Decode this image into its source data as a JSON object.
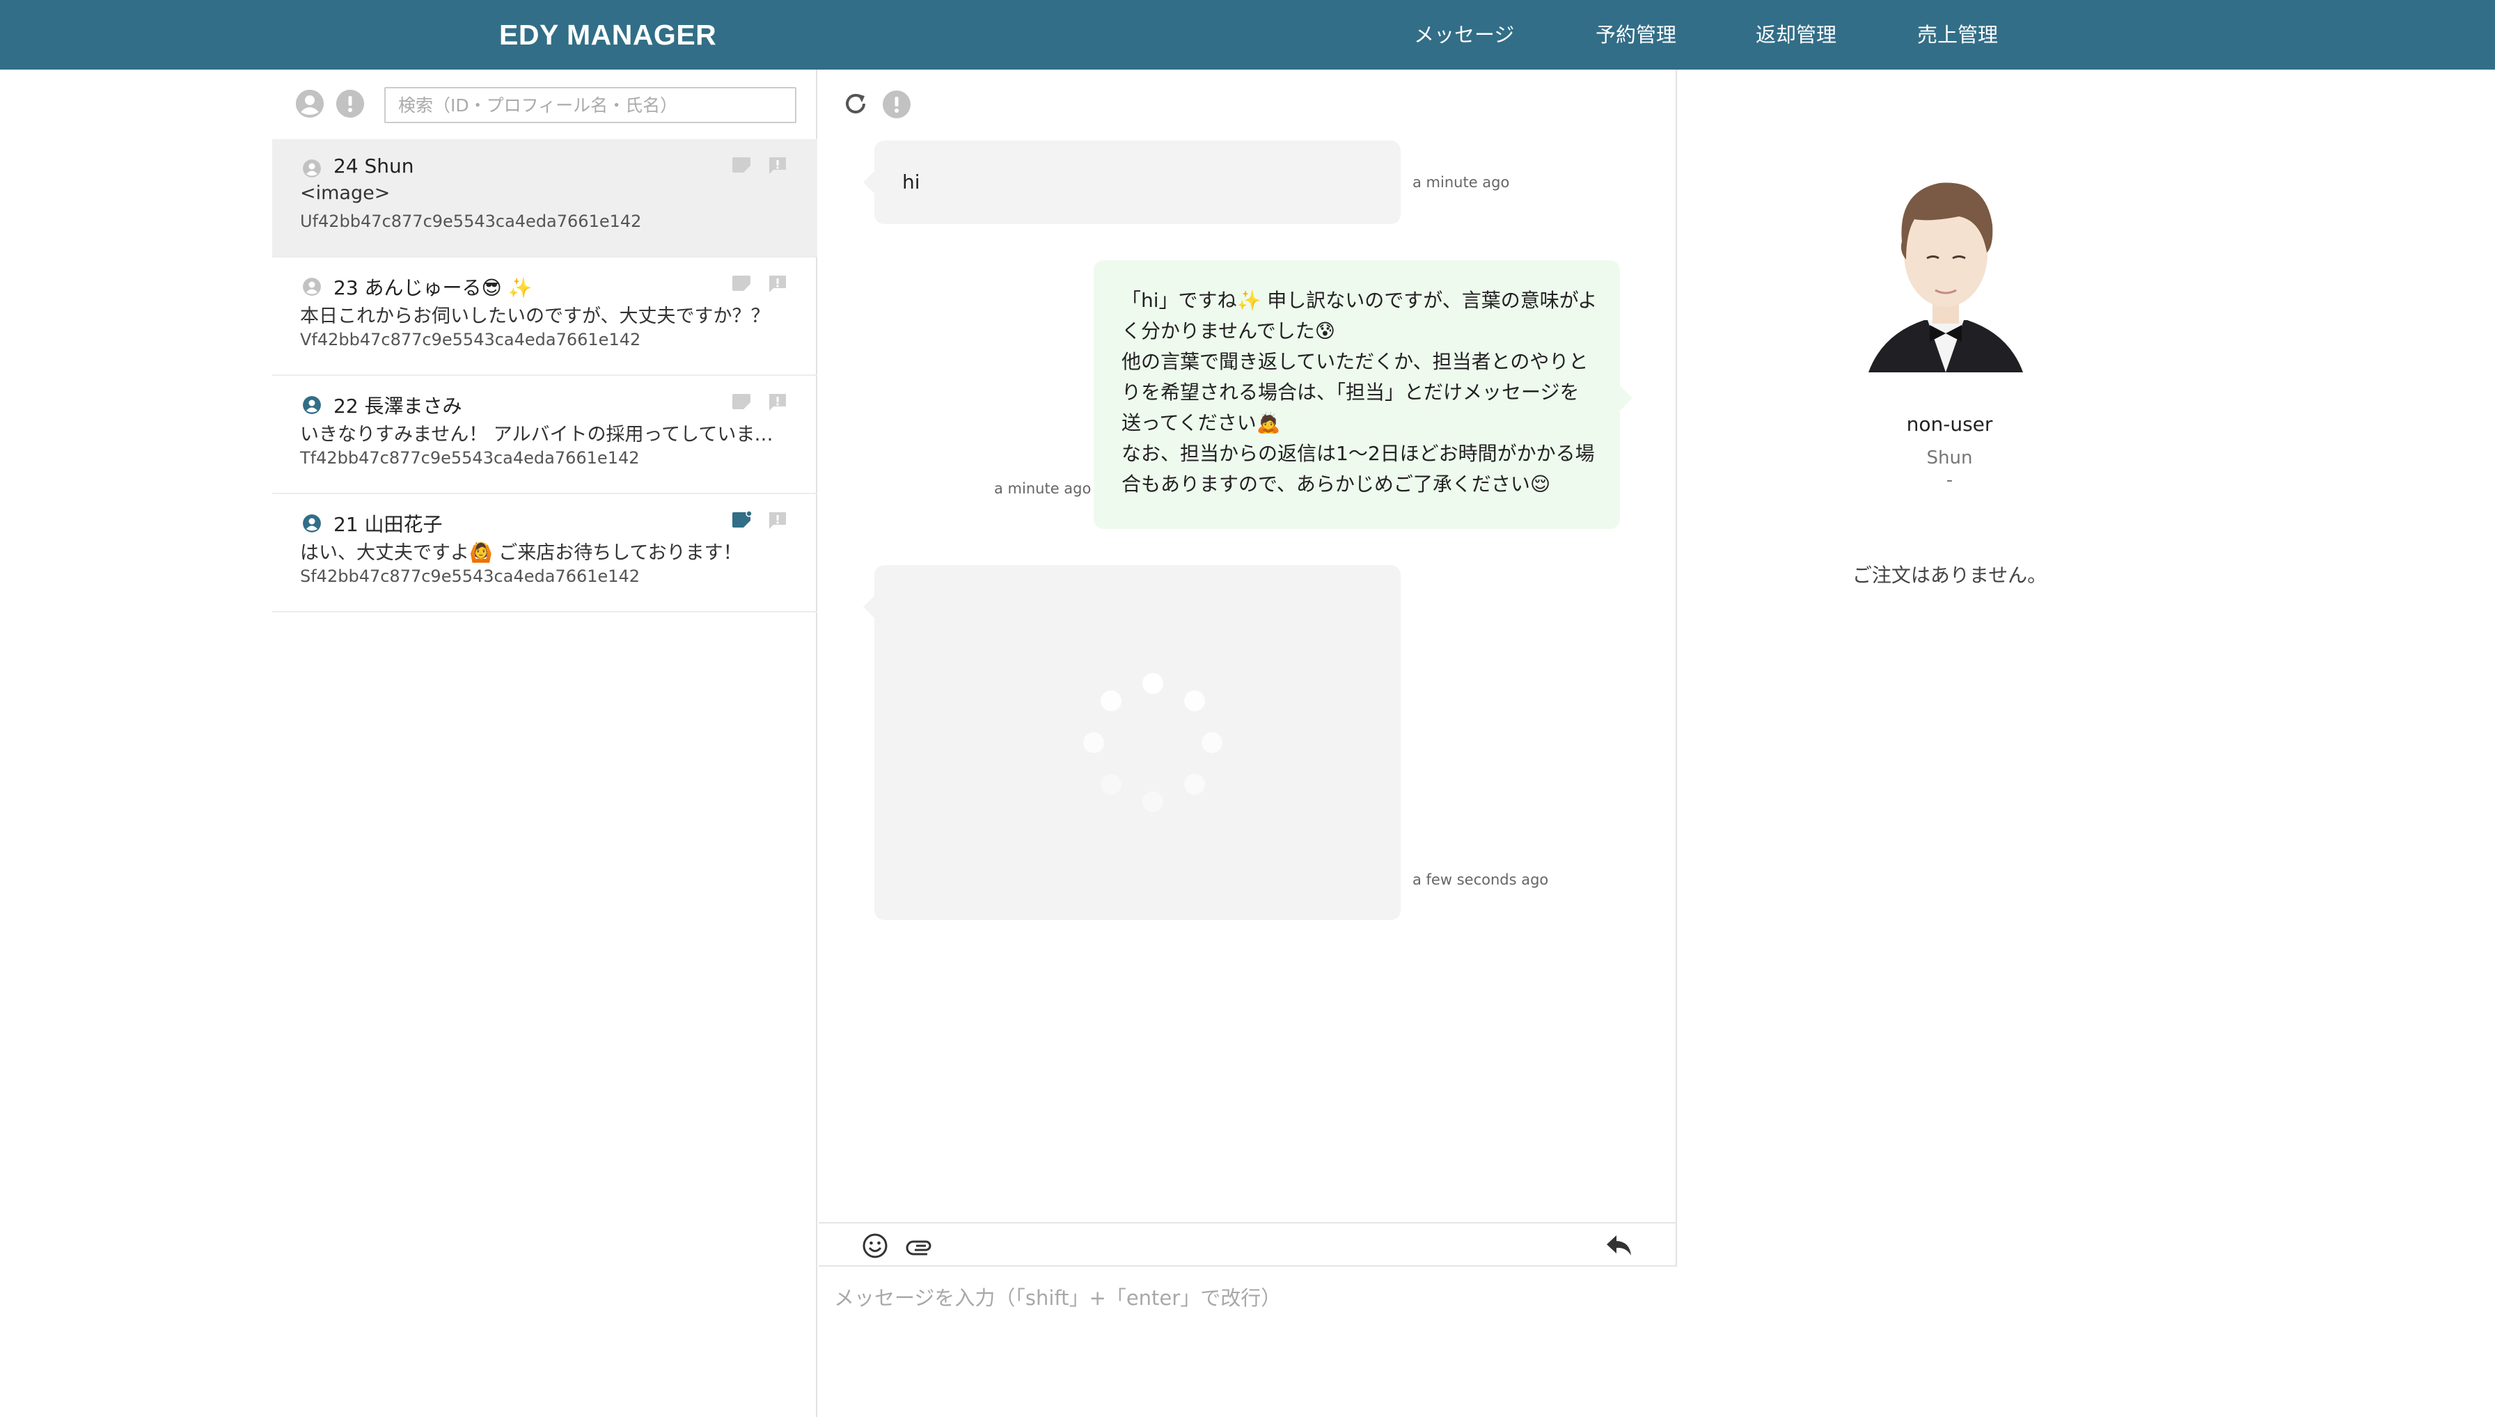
{
  "header": {
    "brand": "EDY MANAGER",
    "nav": [
      {
        "label": "メッセージ"
      },
      {
        "label": "予約管理"
      },
      {
        "label": "返却管理"
      },
      {
        "label": "売上管理"
      }
    ]
  },
  "sidebar": {
    "search_placeholder": "検索（ID・プロフィール名・氏名）",
    "conversations": [
      {
        "title": "24 Shun",
        "preview": "<image>",
        "uid": "Uf42bb47c877c9e5543ca4eda7661e142",
        "active": true,
        "icon_color": "#c2c2c2"
      },
      {
        "title": "23 あんじゅーる😎 ✨",
        "preview": "本日これからお伺いしたいのですが、大丈夫ですか？？",
        "uid": "Vf42bb47c877c9e5543ca4eda7661e142",
        "active": false,
        "icon_color": "#c2c2c2"
      },
      {
        "title": "22 長澤まさみ",
        "preview": "いきなりすみません！ アルバイトの採用ってしていませんか？",
        "uid": "Tf42bb47c877c9e5543ca4eda7661e142",
        "active": false,
        "icon_color": "#326e87"
      },
      {
        "title": "21 山田花子",
        "preview": "はい、大丈夫ですよ🙆 ご来店お待ちしております！",
        "uid": "Sf42bb47c877c9e5543ca4eda7661e142",
        "active": false,
        "icon_color": "#326e87"
      }
    ]
  },
  "chat": {
    "messages": [
      {
        "direction": "in",
        "text": "hi",
        "time": "a minute ago"
      },
      {
        "direction": "out",
        "lines": [
          "「hi」ですね✨ 申し訳ないのですが、言葉の意味がよ",
          "く分かりませんでした😰",
          "他の言葉で聞き返していただくか、担当者とのやりと",
          "りを希望される場合は、「担当」とだけメッセージを",
          "送ってください🙇",
          "なお、担当からの返信は1〜2日ほどお時間がかかる場",
          "合もありますので、あらかじめご了承ください😌"
        ],
        "time": "a minute ago"
      },
      {
        "direction": "in",
        "type": "image-loading",
        "time": "a few seconds ago"
      }
    ],
    "composer_placeholder": "メッセージを入力（「shift」+「enter」で改行）"
  },
  "profile": {
    "status": "non-user",
    "name": "Shun",
    "extra": "-",
    "orders_empty": "ご注文はありません。"
  },
  "colors": {
    "header_bg": "#326e87",
    "accent": "#326e87",
    "outgoing_bubble": "#eefaee",
    "incoming_bubble": "#f3f3f3"
  },
  "icons": [
    "user-icon",
    "alert-icon",
    "reload-icon",
    "emoji-icon",
    "attachment-icon",
    "reply-icon",
    "sticker-icon",
    "message-icon"
  ]
}
